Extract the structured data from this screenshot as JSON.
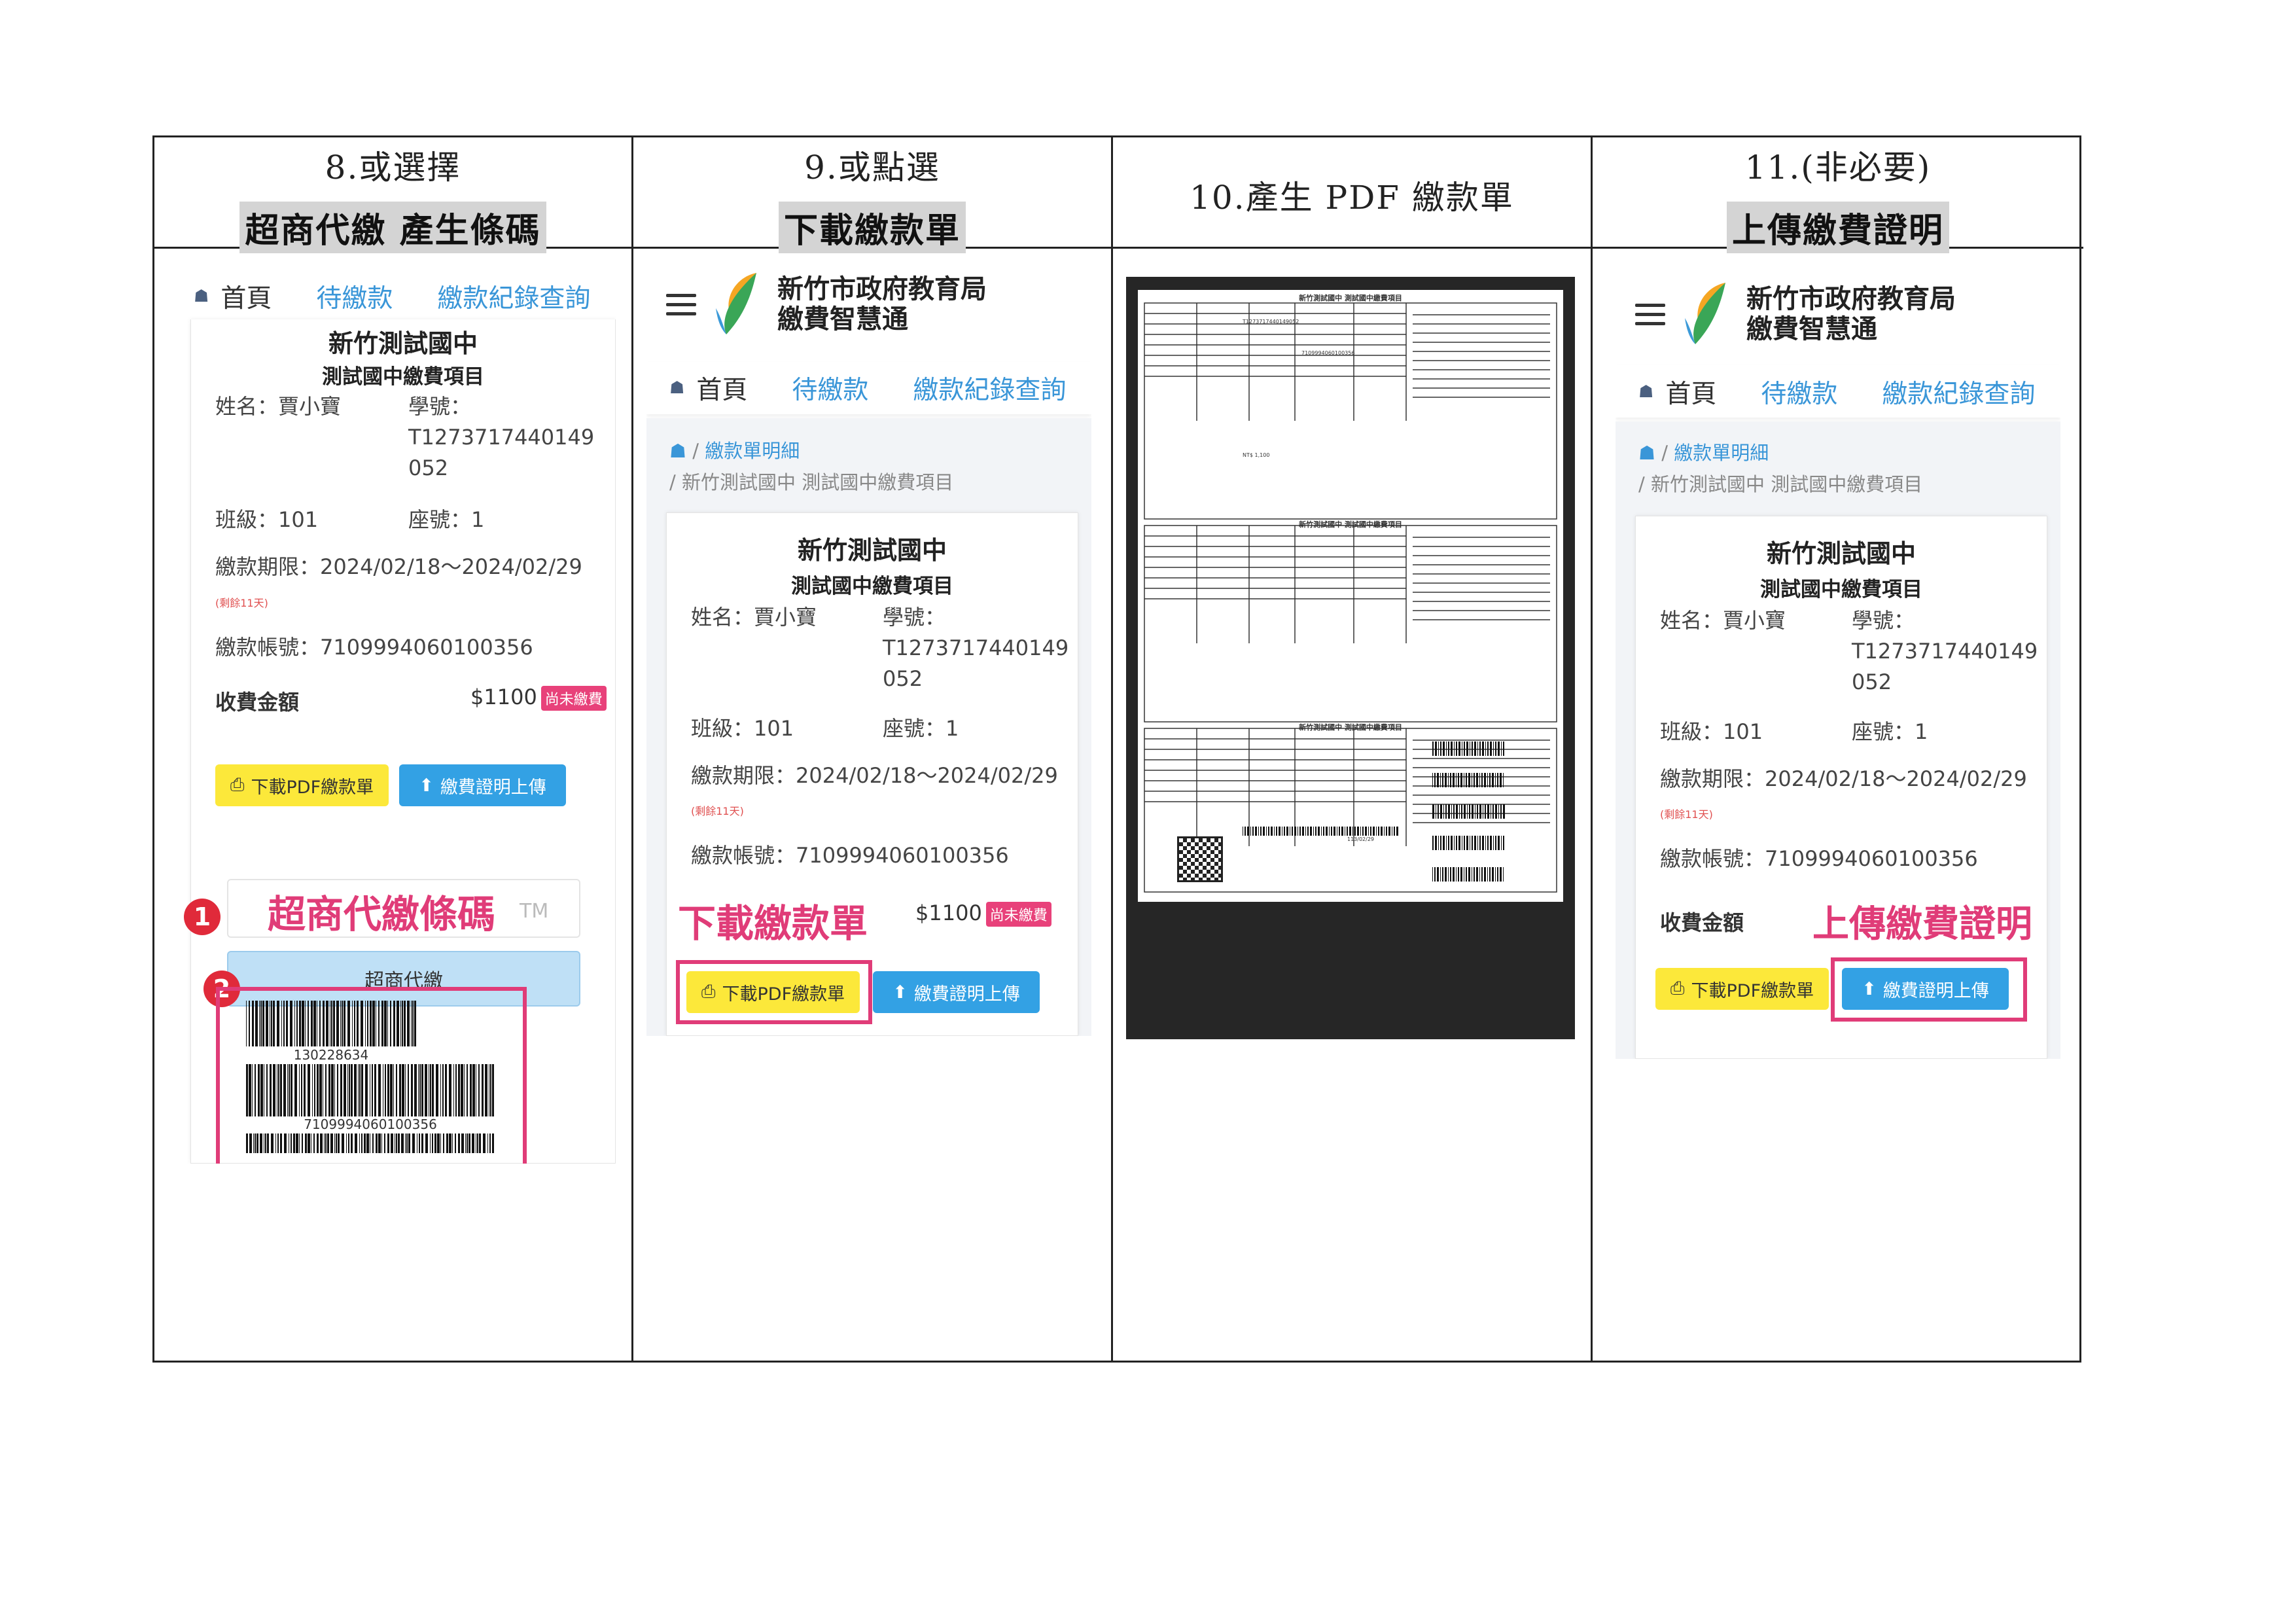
{
  "steps": [
    {
      "number": "8.",
      "title": "或選擇",
      "highlight": "超商代繳 產生條碼"
    },
    {
      "number": "9.",
      "title": "或點選",
      "highlight": "下載繳款單"
    },
    {
      "number": "10.",
      "title": "產生 PDF 繳款單",
      "highlight": ""
    },
    {
      "number": "11.",
      "title": "(非必要)",
      "highlight": "上傳繳費證明"
    }
  ],
  "app": {
    "brand_line1": "新竹市政府教育局",
    "brand_line2": "繳費智慧通",
    "nav": {
      "home": "首頁",
      "pending": "待繳款",
      "history": "繳款紀錄查詢"
    },
    "breadcrumb_title": "繳款單明細",
    "breadcrumb_path": "/ 新竹測試國中 測試國中繳費項目"
  },
  "bill": {
    "school": "新竹測試國中",
    "item": "測試國中繳費項目",
    "name": "姓名：賈小寶",
    "student_id_label": "學號：",
    "student_id_line1": "T1273717440149",
    "student_id_line2": "052",
    "class": "班級：101",
    "seat": "座號：1",
    "period": "繳款期限：2024/02/18～2024/02/29",
    "days_left": "(剩餘11天)",
    "account": "繳款帳號：7109994060100356",
    "amount_label": "收費金額",
    "amount": "$1100",
    "status_badge": "尚未繳費",
    "btn_download": "下載PDF繳款單",
    "btn_upload": "繳費證明上傳"
  },
  "panel1": {
    "callout": "超商代繳條碼",
    "callout_tm": "TM",
    "store_button": "超商代繳",
    "barcode1": "130228634",
    "barcode2": "7109994060100356",
    "badge1": "1",
    "badge2": "2"
  },
  "panel2": {
    "callout": "下載繳款單"
  },
  "panel3": {
    "doc_title": "新竹測試國中 測試國中繳費項目",
    "student_ref": "T1273717440149052",
    "account_ref": "7109994060100356",
    "amount_ref": "NT$ 1,100",
    "due_ref": "113/02/29"
  },
  "panel4": {
    "callout": "上傳繳費證明"
  }
}
